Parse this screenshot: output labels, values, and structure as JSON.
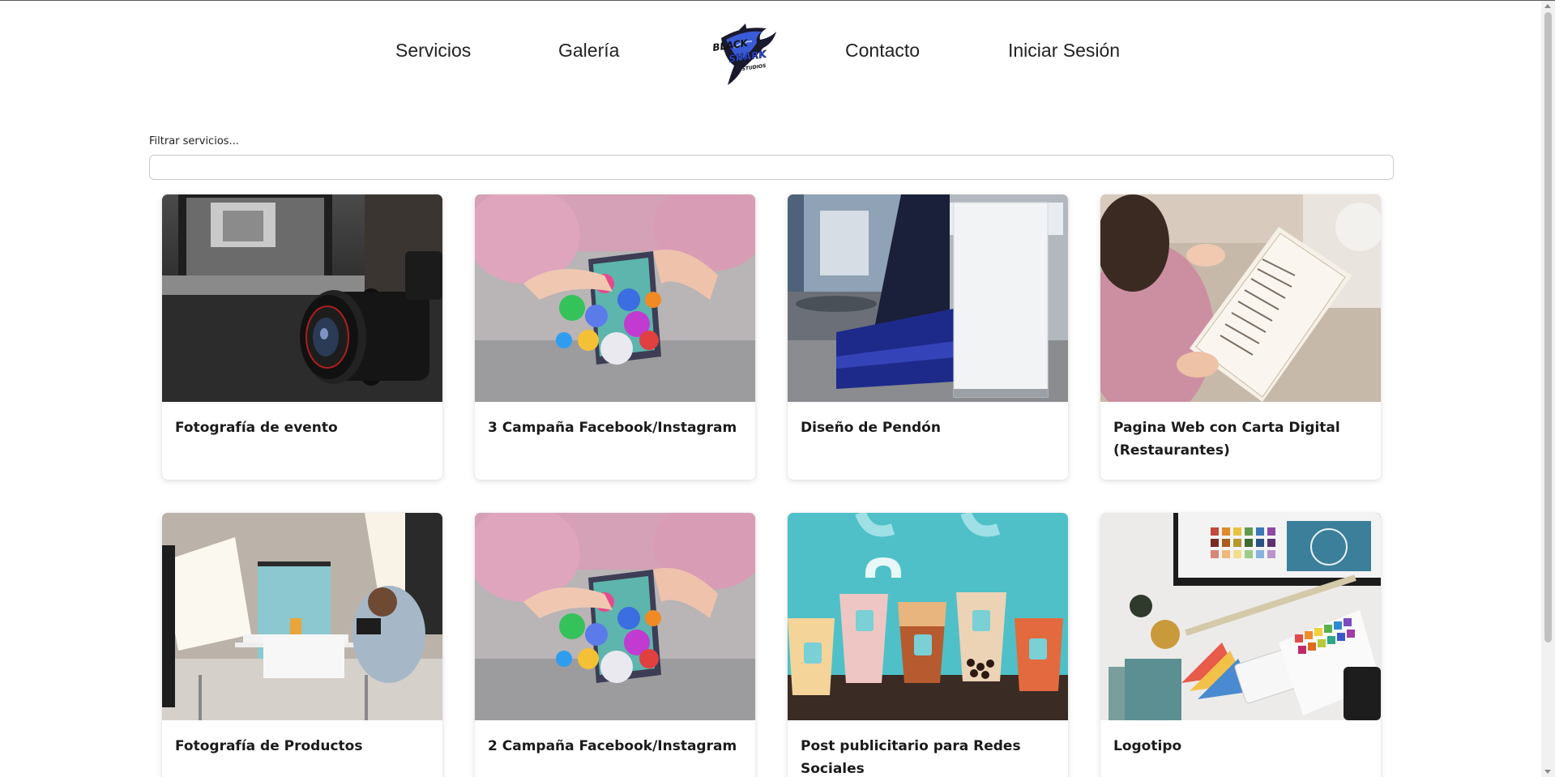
{
  "nav": {
    "services": "Servicios",
    "gallery": "Galería",
    "logo": {
      "line1": "BLACK",
      "line2": "SHARK",
      "line3": "STUDIOS",
      "icon": "shark-logo"
    },
    "contact": "Contacto",
    "login": "Iniciar Sesión"
  },
  "filter": {
    "label": "Filtrar servicios...",
    "value": "",
    "placeholder": ""
  },
  "cards": [
    {
      "title": "Fotografía de evento",
      "image": "camera-lens-photo"
    },
    {
      "title": "3 Campaña Facebook/Instagram",
      "image": "social-media-phone-photo"
    },
    {
      "title": "Diseño de Pendón",
      "image": "banner-stand-photo"
    },
    {
      "title": "Pagina Web con Carta Digital (Restaurantes)",
      "image": "restaurant-menu-photo"
    },
    {
      "title": "Fotografía de Productos",
      "image": "product-studio-photo"
    },
    {
      "title": "2 Campaña Facebook/Instagram",
      "image": "social-media-phone-photo"
    },
    {
      "title": "Post publicitario para Redes Sociales",
      "image": "bubble-tea-cups-photo"
    },
    {
      "title": "Logotipo",
      "image": "design-desk-photo"
    }
  ],
  "colors": {
    "brand_blue": "#3550c8",
    "brand_dark": "#0d0d1a",
    "text": "#1b1b1b",
    "input_border": "#c9c9c9"
  }
}
